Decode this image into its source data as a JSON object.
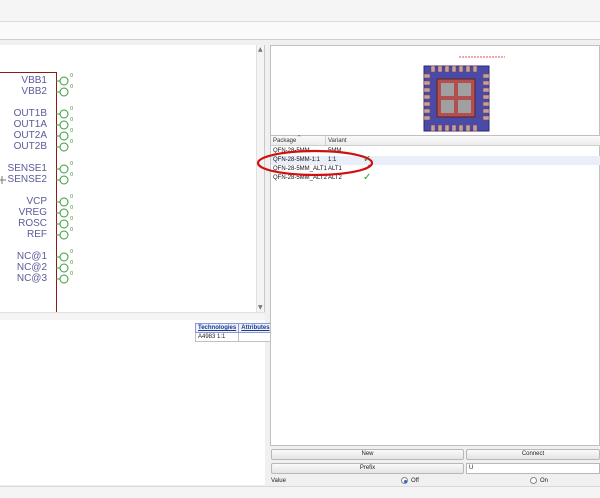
{
  "schematic": {
    "pins": [
      "VBB1",
      "VBB2",
      "OUT1B",
      "OUT1A",
      "OUT2A",
      "OUT2B",
      "SENSE1",
      "SENSE2",
      "VCP",
      "VREG",
      "ROSC",
      "REF",
      "NC@1",
      "NC@2",
      "NC@3"
    ]
  },
  "technologies_table": {
    "headers": [
      "Technologies",
      "Attributes"
    ],
    "rows": [
      [
        "A4983 1:1",
        ""
      ]
    ]
  },
  "packages": {
    "columns": [
      "Package",
      "Variant"
    ],
    "rows": [
      {
        "package": "QFN-28-5MM",
        "variant": "5MM",
        "check": false
      },
      {
        "package": "QFN-28-5MM-1:1",
        "variant": "1:1",
        "check": true,
        "highlighted": true
      },
      {
        "package": "QFN-28-5MM_ALT1",
        "variant": "ALT1",
        "check": true
      },
      {
        "package": "QFN-28-5MM_ALT2",
        "variant": "ALT2",
        "check": true
      }
    ]
  },
  "controls": {
    "new_button": "New",
    "connect_button": "Connect",
    "prefix_button": "Prefix",
    "prefix_value": "U",
    "value_label": "Value",
    "off_label": "Off",
    "on_label": "On",
    "value_selected": "Off"
  },
  "colors": {
    "annotation_ring": "#d01010",
    "pin_text": "#5a5a9a",
    "symbol_outline": "#8b1a1a",
    "pin_circle": "#3a9a3a",
    "check": "#2a9a2a"
  }
}
